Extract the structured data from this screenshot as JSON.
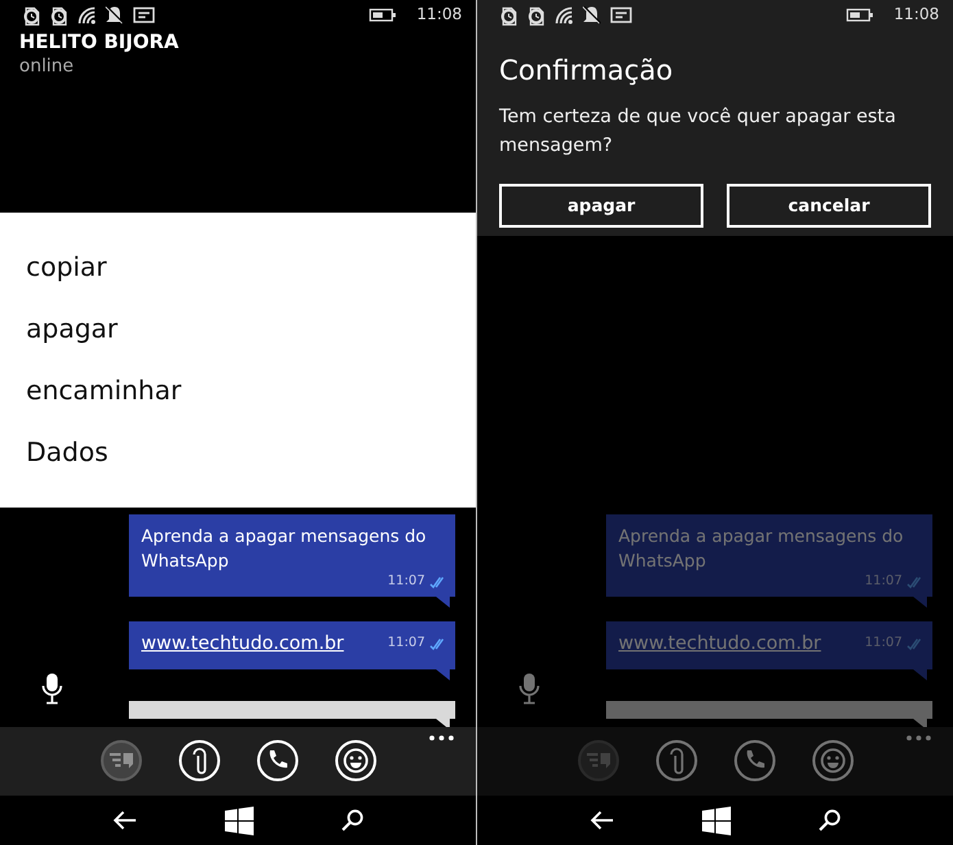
{
  "screens": [
    {
      "dimmed": false,
      "status_bar": {
        "time": "11:08"
      },
      "contact": {
        "name": "HELITO BIJORA",
        "status": "online"
      },
      "menu": [
        "copiar",
        "apagar",
        "encaminhar",
        "Dados"
      ],
      "messages": [
        {
          "kind": "text",
          "text": "Aprenda a apagar mensagens do WhatsApp",
          "time": "11:07"
        },
        {
          "kind": "link",
          "text": "www.techtudo.com.br",
          "time": "11:07"
        }
      ],
      "actions": [
        {
          "kind": "quick-reply",
          "disabled": true
        },
        {
          "kind": "attach",
          "disabled": false
        },
        {
          "kind": "call",
          "disabled": false
        },
        {
          "kind": "emoji",
          "disabled": false
        }
      ]
    },
    {
      "dimmed": true,
      "status_bar": {
        "time": "11:08"
      },
      "dialog": {
        "title": "Confirmação",
        "message": "Tem certeza de que você quer apagar esta mensagem?",
        "buttons": [
          "apagar",
          "cancelar"
        ]
      },
      "messages": [
        {
          "kind": "text",
          "text": "Aprenda a apagar mensagens do WhatsApp",
          "time": "11:07"
        },
        {
          "kind": "link",
          "text": "www.techtudo.com.br",
          "time": "11:07"
        }
      ],
      "actions": [
        {
          "kind": "quick-reply",
          "disabled": true
        },
        {
          "kind": "attach",
          "disabled": false
        },
        {
          "kind": "call",
          "disabled": false
        },
        {
          "kind": "emoji",
          "disabled": false
        }
      ]
    }
  ]
}
